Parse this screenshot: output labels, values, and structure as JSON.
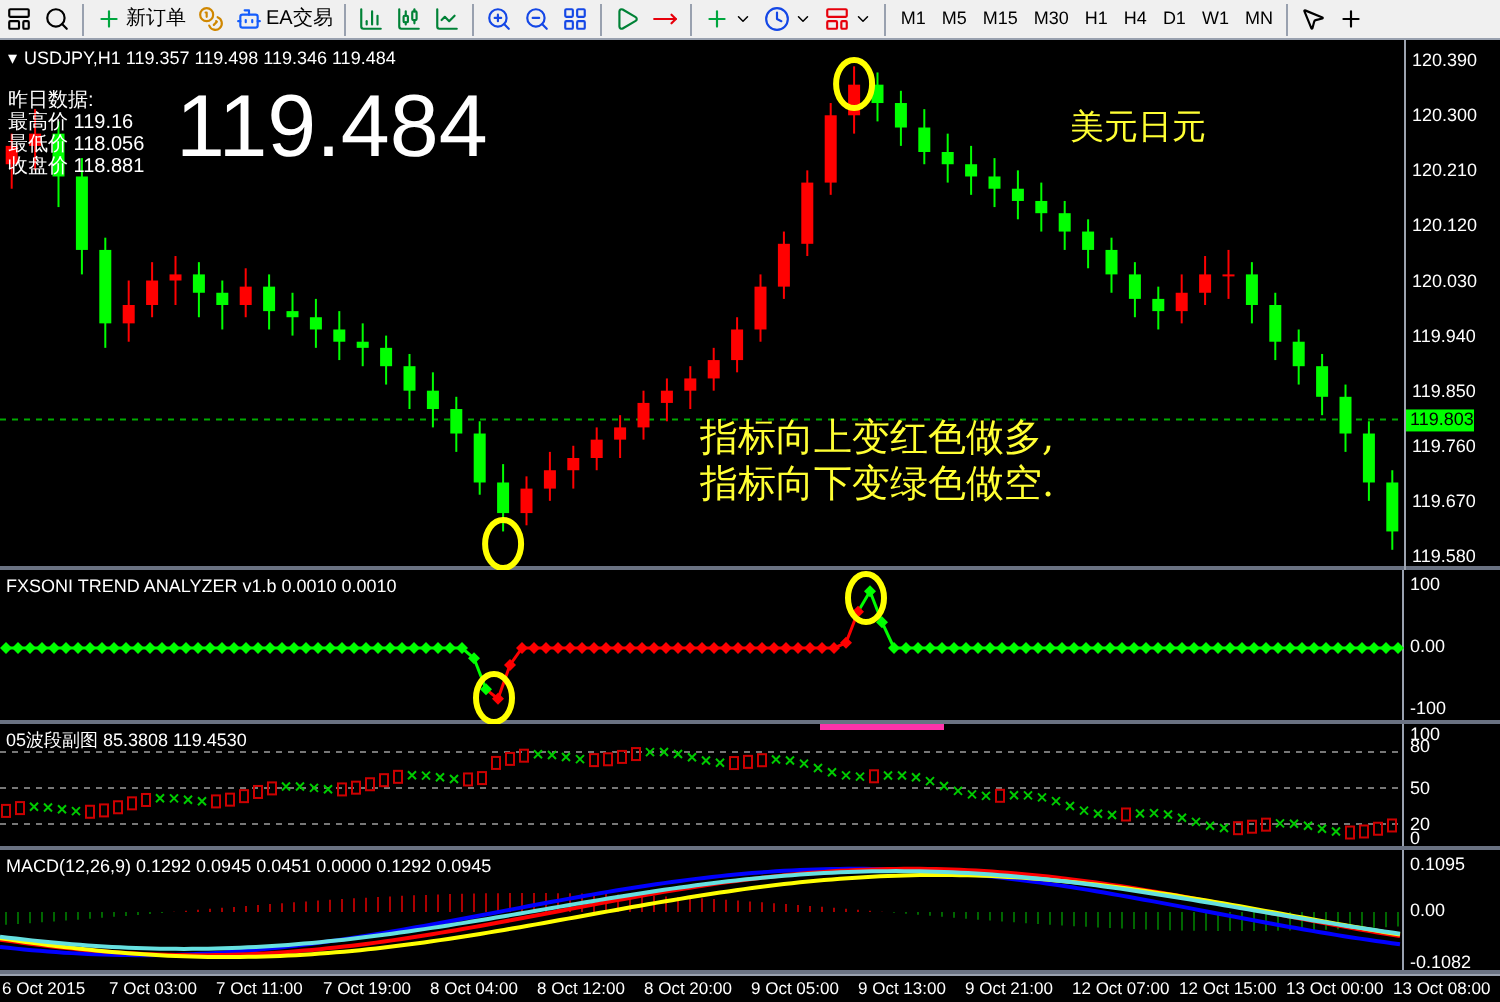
{
  "toolbar": {
    "new_order": "新订单",
    "expert_advisors": "EA交易",
    "timeframes": [
      "M1",
      "M5",
      "M15",
      "M30",
      "H1",
      "H4",
      "D1",
      "W1",
      "MN"
    ]
  },
  "main_chart": {
    "symbol_marker": "▾",
    "symbol": "USDJPY,H1",
    "ohlc": "119.357 119.498 119.346 119.484",
    "info_lines": [
      "昨日数据:",
      "最高价 119.16",
      "最低价 118.056",
      "收盘价 118.881"
    ],
    "big_price": "119.484",
    "pair_label": "美元日元",
    "note_lines": [
      "指标向上变红色做多,",
      "指标向下变绿色做空."
    ],
    "chart_data": {
      "type": "candlestick",
      "ohlc": [
        [
          120.22,
          120.27,
          120.18,
          120.25
        ],
        [
          120.25,
          120.31,
          120.21,
          120.27
        ],
        [
          120.27,
          120.29,
          120.15,
          120.2
        ],
        [
          120.2,
          120.23,
          120.04,
          120.08
        ],
        [
          120.08,
          120.1,
          119.92,
          119.96
        ],
        [
          119.96,
          120.03,
          119.93,
          119.99
        ],
        [
          119.99,
          120.06,
          119.97,
          120.03
        ],
        [
          120.03,
          120.07,
          119.99,
          120.04
        ],
        [
          120.04,
          120.06,
          119.97,
          120.01
        ],
        [
          120.01,
          120.03,
          119.95,
          119.99
        ],
        [
          119.99,
          120.05,
          119.97,
          120.02
        ],
        [
          120.02,
          120.04,
          119.95,
          119.98
        ],
        [
          119.98,
          120.01,
          119.94,
          119.97
        ],
        [
          119.97,
          120.0,
          119.92,
          119.95
        ],
        [
          119.95,
          119.98,
          119.9,
          119.93
        ],
        [
          119.93,
          119.96,
          119.89,
          119.92
        ],
        [
          119.92,
          119.94,
          119.86,
          119.89
        ],
        [
          119.89,
          119.91,
          119.82,
          119.85
        ],
        [
          119.85,
          119.88,
          119.79,
          119.82
        ],
        [
          119.82,
          119.84,
          119.75,
          119.78
        ],
        [
          119.78,
          119.8,
          119.68,
          119.7
        ],
        [
          119.7,
          119.73,
          119.62,
          119.65
        ],
        [
          119.65,
          119.71,
          119.63,
          119.69
        ],
        [
          119.69,
          119.75,
          119.67,
          119.72
        ],
        [
          119.72,
          119.76,
          119.69,
          119.74
        ],
        [
          119.74,
          119.79,
          119.72,
          119.77
        ],
        [
          119.77,
          119.81,
          119.74,
          119.79
        ],
        [
          119.79,
          119.85,
          119.77,
          119.83
        ],
        [
          119.83,
          119.87,
          119.8,
          119.85
        ],
        [
          119.85,
          119.89,
          119.82,
          119.87
        ],
        [
          119.87,
          119.92,
          119.85,
          119.9
        ],
        [
          119.9,
          119.97,
          119.88,
          119.95
        ],
        [
          119.95,
          120.04,
          119.93,
          120.02
        ],
        [
          120.02,
          120.11,
          120.0,
          120.09
        ],
        [
          120.09,
          120.21,
          120.07,
          120.19
        ],
        [
          120.19,
          120.32,
          120.17,
          120.3
        ],
        [
          120.3,
          120.38,
          120.27,
          120.35
        ],
        [
          120.35,
          120.37,
          120.29,
          120.32
        ],
        [
          120.32,
          120.34,
          120.25,
          120.28
        ],
        [
          120.28,
          120.31,
          120.22,
          120.24
        ],
        [
          120.24,
          120.27,
          120.19,
          120.22
        ],
        [
          120.22,
          120.25,
          120.17,
          120.2
        ],
        [
          120.2,
          120.23,
          120.15,
          120.18
        ],
        [
          120.18,
          120.21,
          120.13,
          120.16
        ],
        [
          120.16,
          120.19,
          120.11,
          120.14
        ],
        [
          120.14,
          120.16,
          120.08,
          120.11
        ],
        [
          120.11,
          120.13,
          120.05,
          120.08
        ],
        [
          120.08,
          120.1,
          120.01,
          120.04
        ],
        [
          120.04,
          120.06,
          119.97,
          120.0
        ],
        [
          120.0,
          120.02,
          119.95,
          119.98
        ],
        [
          119.98,
          120.04,
          119.96,
          120.01
        ],
        [
          120.01,
          120.07,
          119.99,
          120.04
        ],
        [
          120.04,
          120.08,
          120.0,
          120.04
        ],
        [
          120.04,
          120.06,
          119.96,
          119.99
        ],
        [
          119.99,
          120.01,
          119.9,
          119.93
        ],
        [
          119.93,
          119.95,
          119.86,
          119.89
        ],
        [
          119.89,
          119.91,
          119.81,
          119.84
        ],
        [
          119.84,
          119.86,
          119.75,
          119.78
        ],
        [
          119.78,
          119.8,
          119.67,
          119.7
        ],
        [
          119.7,
          119.72,
          119.59,
          119.62
        ]
      ],
      "ylim": [
        119.557,
        120.423
      ],
      "ref_lines": [
        {
          "axis": "y",
          "value": 119.803,
          "label": "119.803"
        }
      ],
      "yticks": [
        {
          "value": 120.39,
          "label": "120.390"
        },
        {
          "value": 120.3,
          "label": "120.300"
        },
        {
          "value": 120.21,
          "label": "120.210"
        },
        {
          "value": 120.12,
          "label": "120.120"
        },
        {
          "value": 120.03,
          "label": "120.030"
        },
        {
          "value": 119.94,
          "label": "119.940"
        },
        {
          "value": 119.85,
          "label": "119.850"
        },
        {
          "value": 119.76,
          "label": "119.760"
        },
        {
          "value": 119.67,
          "label": "119.670"
        },
        {
          "value": 119.58,
          "label": "119.580"
        }
      ]
    }
  },
  "indicators": [
    {
      "kind": "trend",
      "label": "FXSONI TREND ANALYZER v1.b 0.0010 0.0010",
      "axis_labels": [
        "100",
        "0.00",
        "-100"
      ]
    },
    {
      "kind": "oscillator",
      "label": "05波段副图 85.3808 119.4530",
      "axis_labels": [
        "100",
        "80",
        "50",
        "20",
        "0"
      ]
    },
    {
      "kind": "macd",
      "label": "MACD(12,26,9) 0.1292 0.0945 0.0451 0.0000 0.1292 0.0945",
      "axis_labels": [
        "0.1095",
        "0.00",
        "-0.1082"
      ]
    }
  ],
  "time_labels": [
    "6 Oct 2015",
    "7 Oct 03:00",
    "7 Oct 11:00",
    "7 Oct 19:00",
    "8 Oct 04:00",
    "8 Oct 12:00",
    "8 Oct 20:00",
    "9 Oct 05:00",
    "9 Oct 13:00",
    "9 Oct 21:00",
    "12 Oct 07:00",
    "12 Oct 15:00",
    "13 Oct 00:00",
    "13 Oct 08:00"
  ]
}
